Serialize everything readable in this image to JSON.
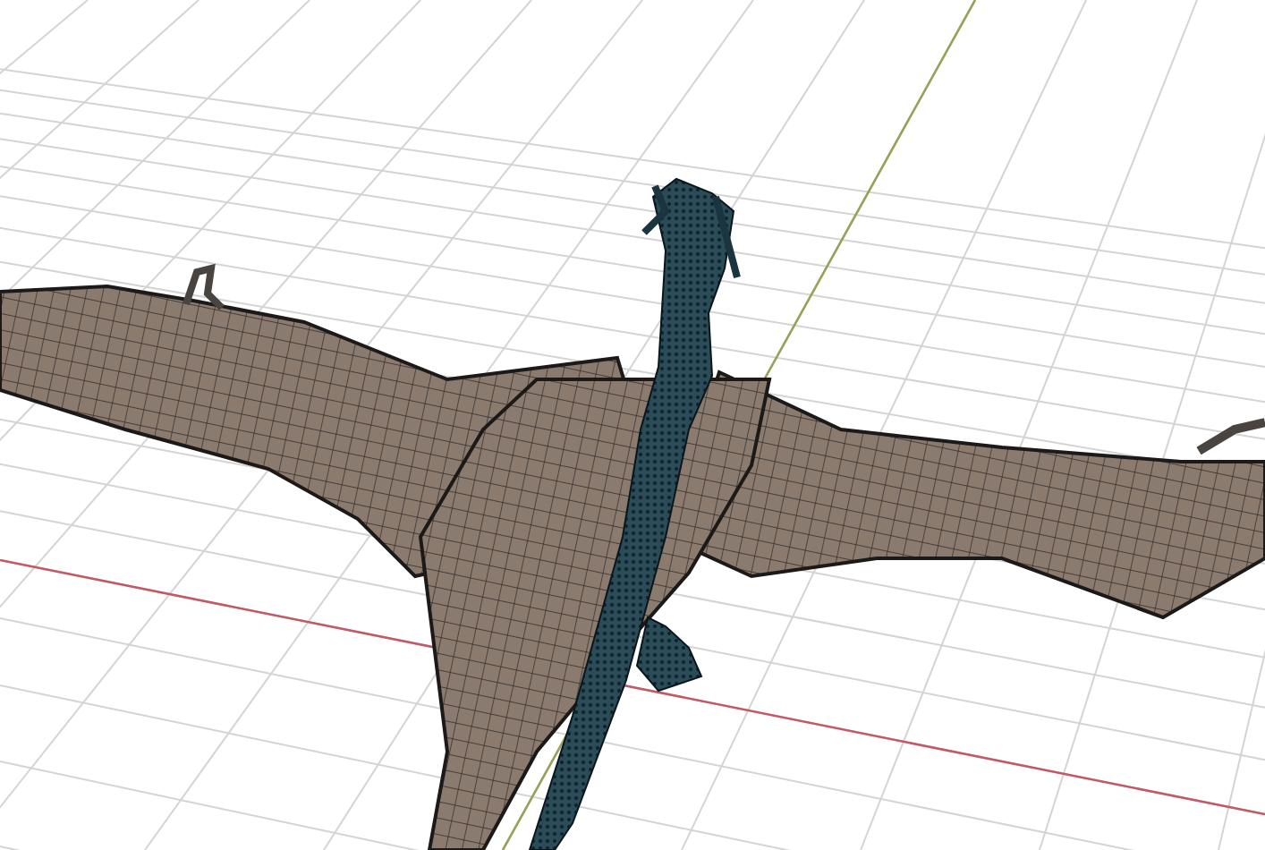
{
  "viewport": {
    "axes": [
      {
        "kind": "x",
        "color": "#c25a66"
      },
      {
        "kind": "y",
        "color": "#9aa05a"
      }
    ]
  }
}
